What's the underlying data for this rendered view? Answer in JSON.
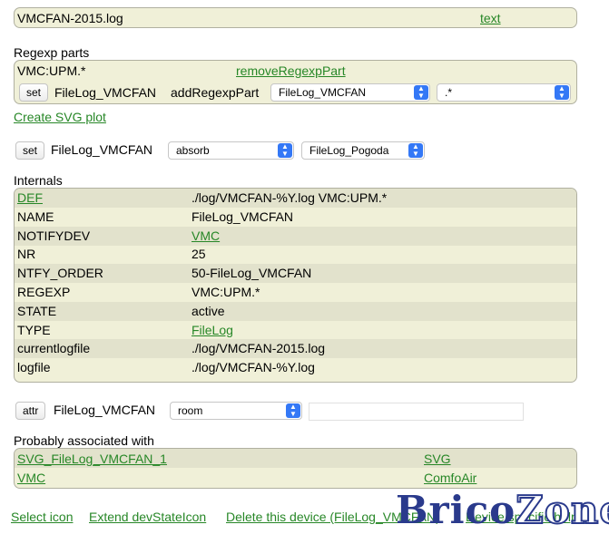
{
  "device_header": {
    "name": "VMCFAN-2015.log",
    "text_link": "text"
  },
  "regexp": {
    "section_title": "Regexp parts",
    "part": "VMC:UPM.*",
    "remove_link": "removeRegexpPart",
    "set_label": "set",
    "device": "FileLog_VMCFAN",
    "add_label": "addRegexpPart",
    "device_select": "FileLog_VMCFAN",
    "pattern_select": ".*",
    "create_plot_link": "Create SVG plot"
  },
  "set_cmd": {
    "set_label": "set",
    "device": "FileLog_VMCFAN",
    "cmd_select": "absorb",
    "target_select": "FileLog_Pogoda"
  },
  "internals": {
    "section_title": "Internals",
    "rows": [
      {
        "key": "DEF",
        "value": "./log/VMCFAN-%Y.log VMC:UPM.*",
        "key_link": true,
        "value_link": false
      },
      {
        "key": "NAME",
        "value": "FileLog_VMCFAN",
        "key_link": false,
        "value_link": false
      },
      {
        "key": "NOTIFYDEV",
        "value": "VMC",
        "key_link": false,
        "value_link": true
      },
      {
        "key": "NR",
        "value": "25",
        "key_link": false,
        "value_link": false
      },
      {
        "key": "NTFY_ORDER",
        "value": "50-FileLog_VMCFAN",
        "key_link": false,
        "value_link": false
      },
      {
        "key": "REGEXP",
        "value": "VMC:UPM.*",
        "key_link": false,
        "value_link": false
      },
      {
        "key": "STATE",
        "value": "active",
        "key_link": false,
        "value_link": false
      },
      {
        "key": "TYPE",
        "value": "FileLog",
        "key_link": false,
        "value_link": true
      },
      {
        "key": "currentlogfile",
        "value": "./log/VMCFAN-2015.log",
        "key_link": false,
        "value_link": false
      },
      {
        "key": "logfile",
        "value": "./log/VMCFAN-%Y.log",
        "key_link": false,
        "value_link": false
      }
    ]
  },
  "attr": {
    "attr_label": "attr",
    "device": "FileLog_VMCFAN",
    "attr_select": "room",
    "value": ""
  },
  "associated": {
    "section_title": "Probably associated with",
    "rows": [
      {
        "name": "SVG_FileLog_VMCFAN_1",
        "type": "SVG"
      },
      {
        "name": "VMC",
        "type": "ComfoAir"
      }
    ]
  },
  "footer": {
    "select_icon": "Select icon",
    "extend": "Extend devStateIcon",
    "delete": "Delete this device (FileLog_VMCFAN)",
    "help": "Device specific help"
  },
  "watermark": {
    "part1": "Brico",
    "part2": "Zone"
  },
  "colors": {
    "link": "#278727",
    "panel_bg": "#f0f0d8",
    "panel_alt": "#e2e2cc",
    "select_arrow": "#3478f6"
  }
}
